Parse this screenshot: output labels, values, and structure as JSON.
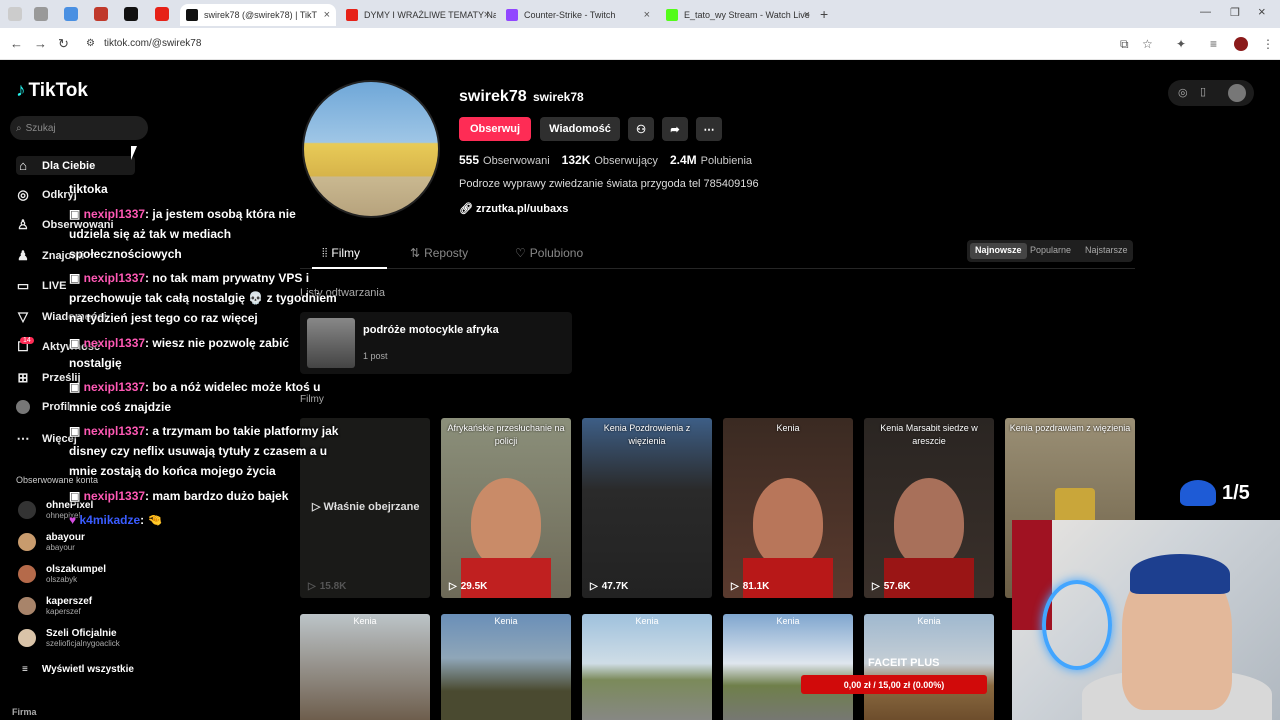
{
  "browser": {
    "tabs": [
      {
        "label": "swirek78 (@swirek78) | TikT",
        "active": true
      },
      {
        "label": "DYMY I WRAŻLIWE TEMATY Na",
        "active": false
      },
      {
        "label": "Counter-Strike - Twitch",
        "active": false
      },
      {
        "label": "E_tato_wy Stream - Watch Live",
        "active": false
      }
    ],
    "url": "tiktok.com/@swirek78"
  },
  "sidebar": {
    "logo": "TikTok",
    "search_placeholder": "Szukaj",
    "nav": [
      {
        "label": "Dla Ciebie",
        "icon": "home-icon"
      },
      {
        "label": "Odkryj",
        "icon": "compass-icon"
      },
      {
        "label": "Obserwowani",
        "icon": "user-follow-icon"
      },
      {
        "label": "Znajomi",
        "icon": "friends-icon"
      },
      {
        "label": "LIVE",
        "icon": "live-icon"
      },
      {
        "label": "Wiadomości",
        "icon": "send-icon"
      },
      {
        "label": "Aktywność",
        "icon": "inbox-icon"
      },
      {
        "label": "Prześlij",
        "icon": "upload-icon"
      },
      {
        "label": "Profil",
        "icon": "avatar"
      },
      {
        "label": "Więcej",
        "icon": "more-icon"
      }
    ],
    "activity_badge": "14",
    "following_title": "Obserwowane konta",
    "following": [
      {
        "name": "ohnePixel",
        "handle": "ohnepixel"
      },
      {
        "name": "abayour",
        "handle": "abayour"
      },
      {
        "name": "olszakumpel",
        "handle": "olszabyk"
      },
      {
        "name": "kaperszef",
        "handle": "kaperszef"
      },
      {
        "name": "Szeli Oficjalnie",
        "handle": "szelioficjalnygoaclick"
      }
    ],
    "show_all": "Wyświetl wszystkie",
    "footer": "Firma"
  },
  "profile": {
    "username": "swirek78",
    "nickname": "swirek78",
    "follow_label": "Obserwuj",
    "message_label": "Wiadomość",
    "following_count": "555",
    "following_label": "Obserwowani",
    "followers_count": "132K",
    "followers_label": "Obserwujący",
    "likes_count": "2.4M",
    "likes_label": "Polubienia",
    "bio": "Podroze wyprawy zwiedzanie świata przygoda tel 785409196",
    "link": "zrzutka.pl/uubaxs",
    "tabs": [
      "Filmy",
      "Reposty",
      "Polubiono"
    ],
    "sort": [
      "Najnowsze",
      "Popularne",
      "Najstarsze"
    ],
    "playlists_title": "Listy odtwarzania",
    "playlist_name": "podróże motocykle afryka",
    "playlist_count": "1 post",
    "videos_title": "Filmy",
    "watched_label": "Właśnie obejrzane",
    "videos": [
      {
        "caption": "",
        "views": "15.8K"
      },
      {
        "caption": "Afrykańskie przesłuchanie na policji",
        "views": "29.5K"
      },
      {
        "caption": "Kenia Pozdrowienia z więzienia",
        "views": "47.7K"
      },
      {
        "caption": "Kenia",
        "views": "81.1K"
      },
      {
        "caption": "Kenia Marsabit siedze w areszcie",
        "views": "57.6K"
      },
      {
        "caption": "Kenia pozdrawiam z więzienia",
        "views": ""
      }
    ],
    "videos_row2": [
      {
        "caption": "Kenia"
      },
      {
        "caption": "Kenia"
      },
      {
        "caption": "Kenia"
      },
      {
        "caption": "Kenia"
      },
      {
        "caption": "Kenia"
      }
    ]
  },
  "stream": {
    "chat": [
      {
        "user": "",
        "text": "tiktoka"
      },
      {
        "user": "nexipl1337",
        "text": ": ja jestem osobą która nie udziela się aż tak w mediach społecznościowych"
      },
      {
        "user": "nexipl1337",
        "text": ": no tak mam prywatny VPS i przechowuje tak całą nostalgię 💀 z tygodniem na tydzień jest tego co raz więcej"
      },
      {
        "user": "nexipl1337",
        "text": ": wiesz nie pozwolę zabić nostalgię"
      },
      {
        "user": "nexipl1337",
        "text": ": bo a nóż widelec może ktoś u mnie coś znajdzie"
      },
      {
        "user": "nexipl1337",
        "text": ": a trzymam bo takie platformy jak disney czy neflix usuwają tytuły z czasem a u mnie zostają do końca mojego życia"
      },
      {
        "user": "nexipl1337",
        "text": ": mam bardzo dużo bajek"
      },
      {
        "user": "k4mikadze",
        "text": ": 🤏"
      }
    ],
    "counter": "1/5",
    "faceit": "FACEIT PLUS",
    "donation": "0,00 zł / 15,00 zł (0.00%)"
  }
}
